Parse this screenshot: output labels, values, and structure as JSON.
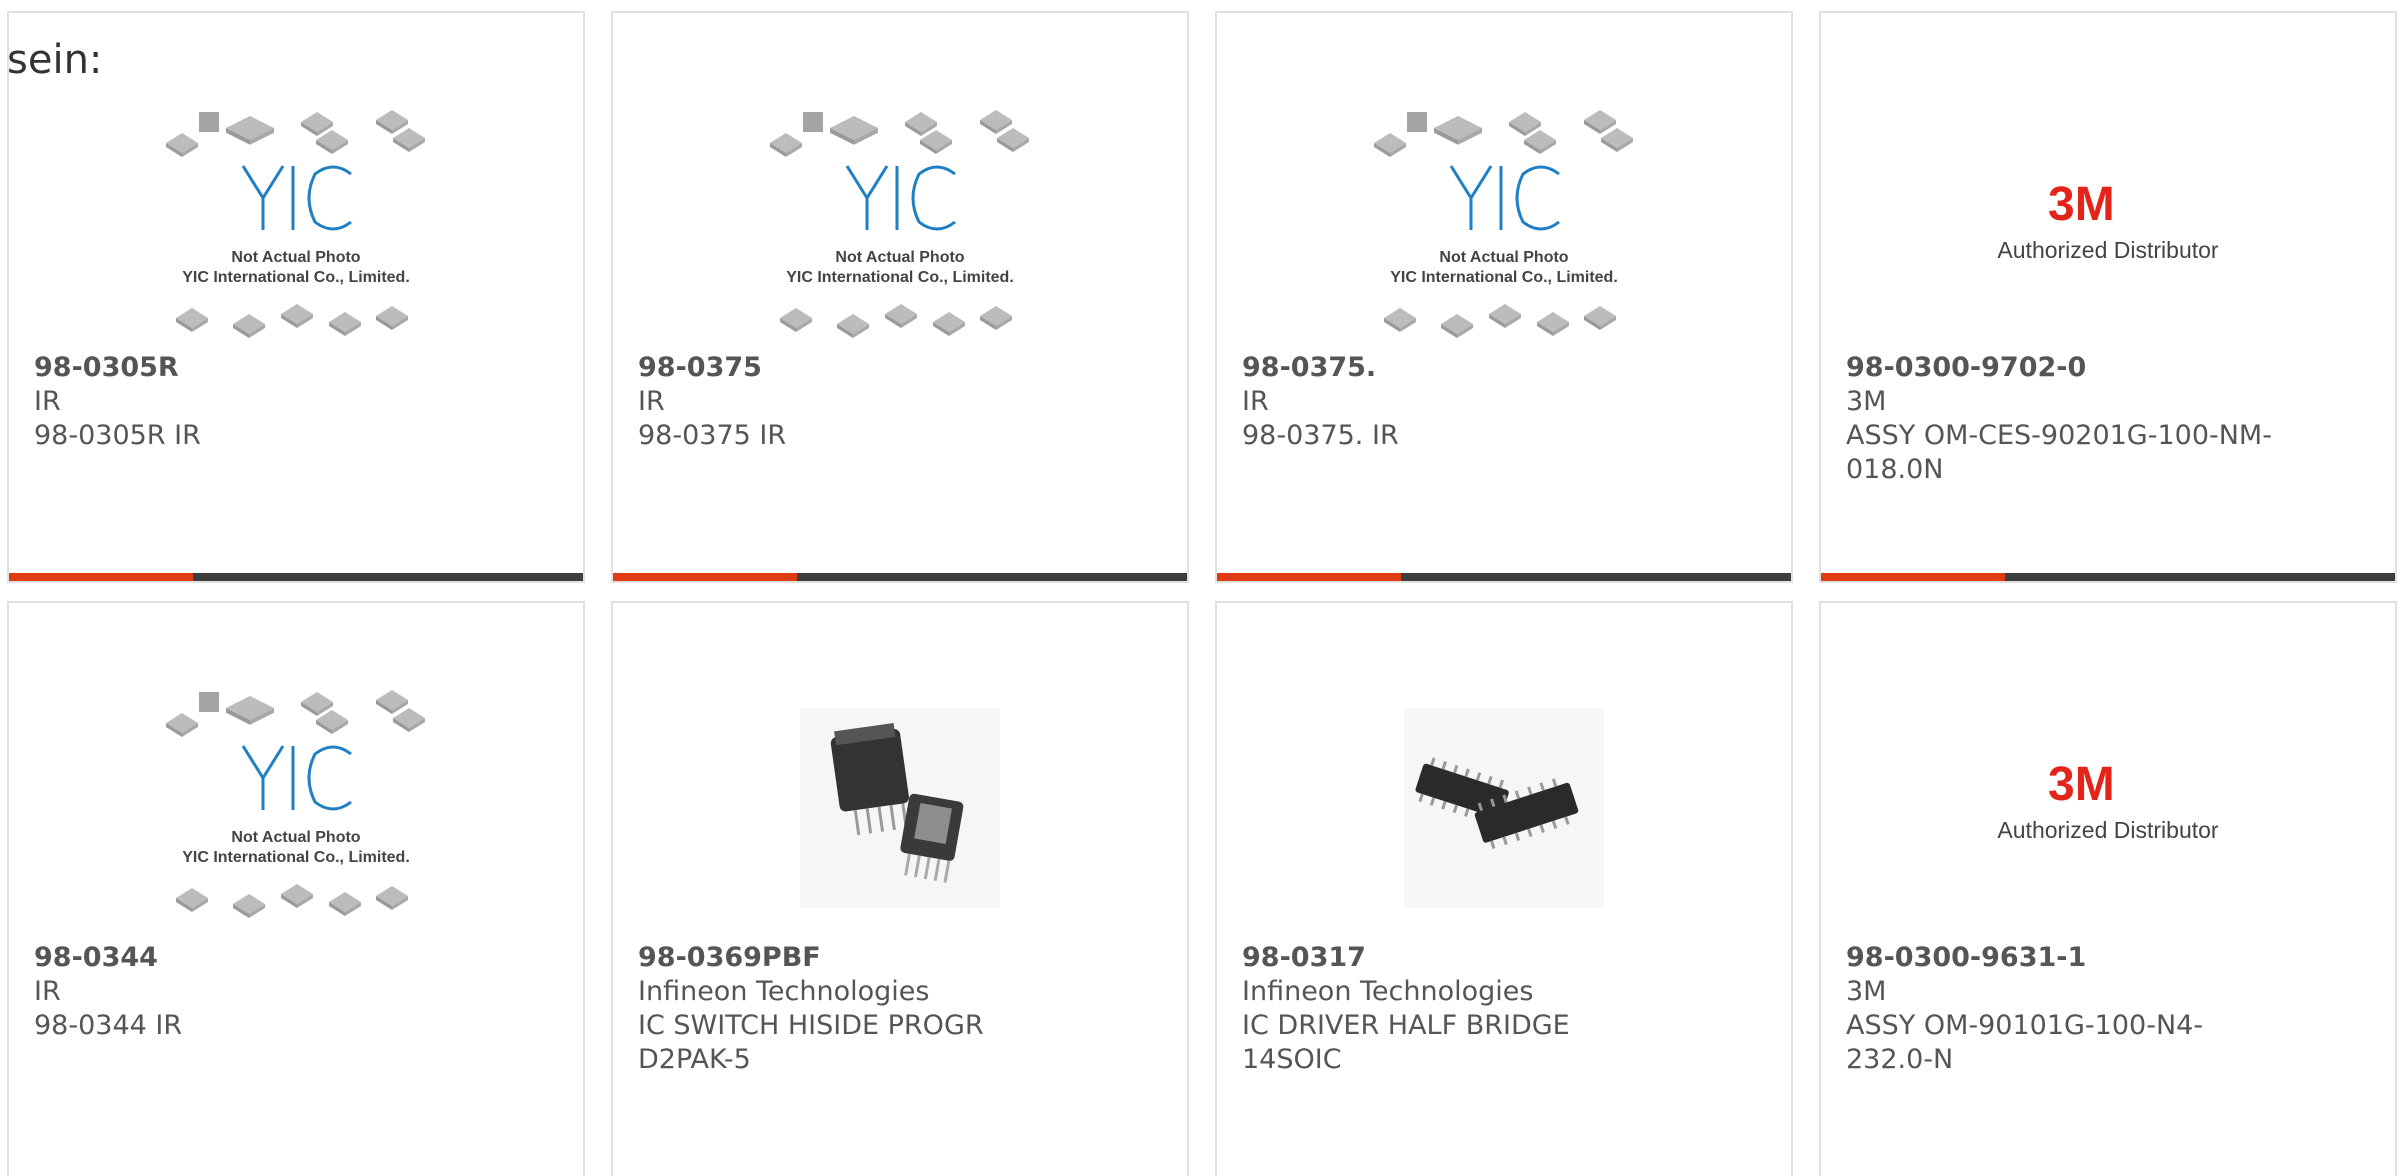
{
  "page": {
    "prefix_text": "sein:"
  },
  "colors": {
    "accent": "#e03c14",
    "bar_dark": "#3d3d3d",
    "border": "#e1e1e1",
    "text": "#555555",
    "brand_3m": "#e3241b",
    "yic_blue": "#1f7fc4"
  },
  "image_text": {
    "yic_line1": "Not Actual Photo",
    "yic_line2": "YIC International Co., Limited.",
    "m3_brand": "3M",
    "m3_caption": "Authorized Distributor"
  },
  "products": [
    {
      "part": "98-0305R",
      "manufacturer": "IR",
      "description": "98-0305R IR",
      "image": "yic-placeholder"
    },
    {
      "part": "98-0375",
      "manufacturer": "IR",
      "description": "98-0375 IR",
      "image": "yic-placeholder"
    },
    {
      "part": "98-0375.",
      "manufacturer": "IR",
      "description": "98-0375. IR",
      "image": "yic-placeholder"
    },
    {
      "part": "98-0300-9702-0",
      "manufacturer": "3M",
      "description": "ASSY OM-CES-90201G-100-NM-018.0N",
      "image": "3m-logo"
    },
    {
      "part": "98-0344",
      "manufacturer": "IR",
      "description": "98-0344 IR",
      "image": "yic-placeholder"
    },
    {
      "part": "98-0369PBF",
      "manufacturer": "Infineon Technologies",
      "description": "IC SWITCH HISIDE PROGR D2PAK-5",
      "image": "d2pak-photo"
    },
    {
      "part": "98-0317",
      "manufacturer": "Infineon Technologies",
      "description": "IC DRIVER HALF BRIDGE 14SOIC",
      "image": "soic-photo"
    },
    {
      "part": "98-0300-9631-1",
      "manufacturer": "3M",
      "description": "ASSY OM-90101G-100-N4-232.0-N",
      "image": "3m-logo"
    }
  ]
}
